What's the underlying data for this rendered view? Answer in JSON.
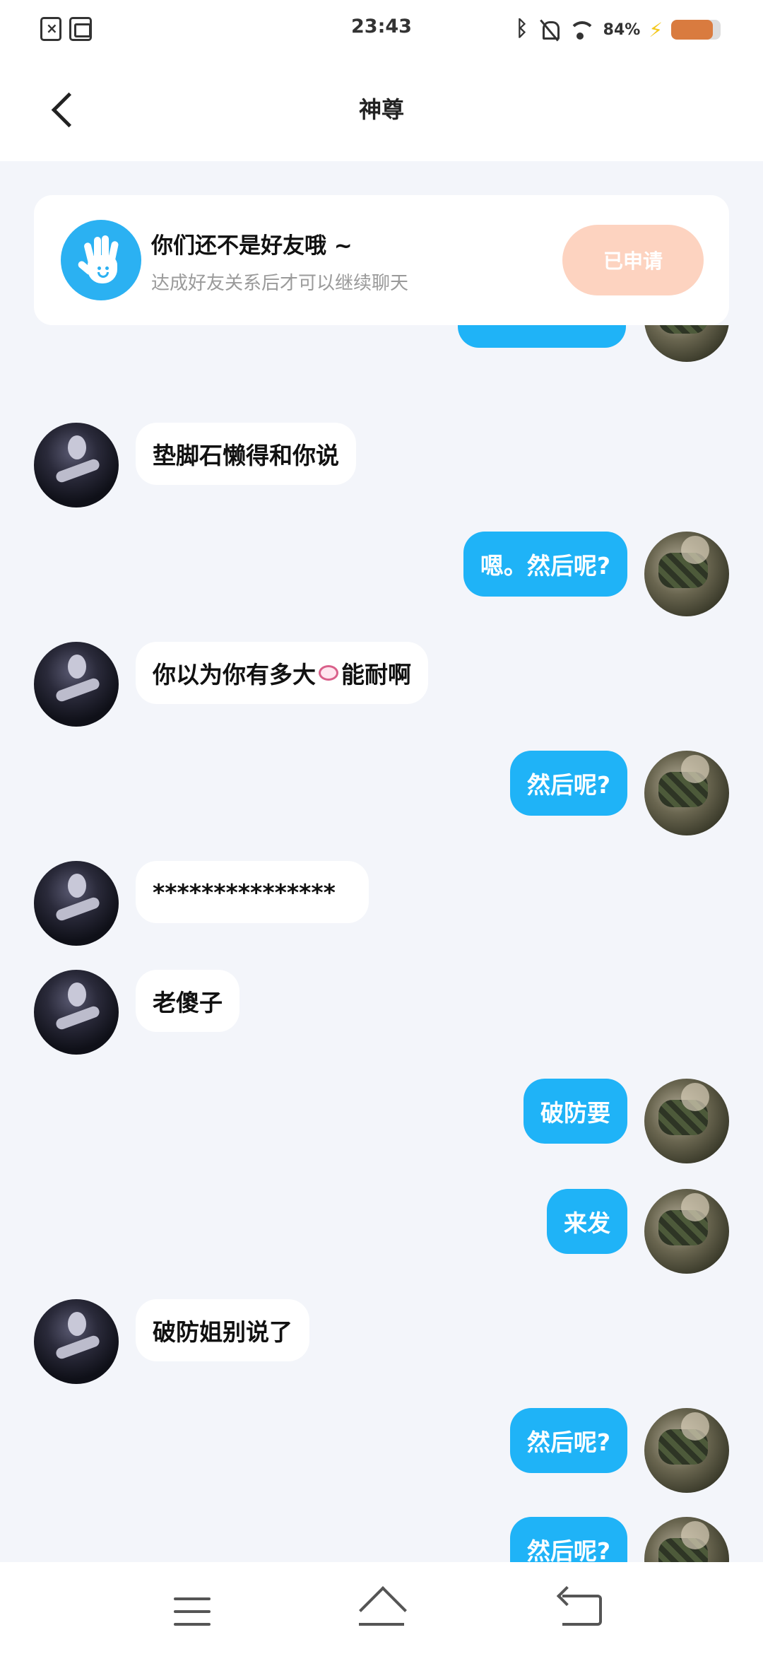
{
  "status_bar": {
    "time": "23:43",
    "battery_percent": "84%",
    "battery_level": 0.84,
    "icons": [
      "sim-error-icon",
      "app-notification-icon",
      "bluetooth-icon",
      "mute-bell-icon",
      "wifi-icon",
      "charging-icon",
      "battery-icon"
    ]
  },
  "header": {
    "title": "神尊"
  },
  "notice": {
    "title": "你们还不是好友哦 ~",
    "subtitle": "达成好友关系后才可以继续聊天",
    "button_label": "已申请"
  },
  "messages": [
    {
      "from": "me",
      "text": ""
    },
    {
      "from": "her",
      "text": "垫脚石懒得和你说"
    },
    {
      "from": "me",
      "text": "嗯。然后呢?"
    },
    {
      "from": "her",
      "text_before": "你以为你有多大",
      "text_after": "能耐啊"
    },
    {
      "from": "me",
      "text": "然后呢?"
    },
    {
      "from": "her",
      "text": "***************"
    },
    {
      "from": "her",
      "text": "老傻子"
    },
    {
      "from": "me",
      "text": "破防要"
    },
    {
      "from": "me",
      "text": "来发"
    },
    {
      "from": "her",
      "text": "破防姐别说了"
    },
    {
      "from": "me",
      "text": "然后呢?"
    },
    {
      "from": "me",
      "text": "然后呢?"
    }
  ],
  "nav": {
    "icons": [
      "menu-icon",
      "home-icon",
      "back-icon"
    ]
  },
  "colors": {
    "outgoing_bubble": "#1fb3f7",
    "incoming_bubble": "#ffffff",
    "background": "#f3f5fa",
    "applied_button": "#fdd3c0",
    "notice_icon": "#2bb1f2"
  }
}
